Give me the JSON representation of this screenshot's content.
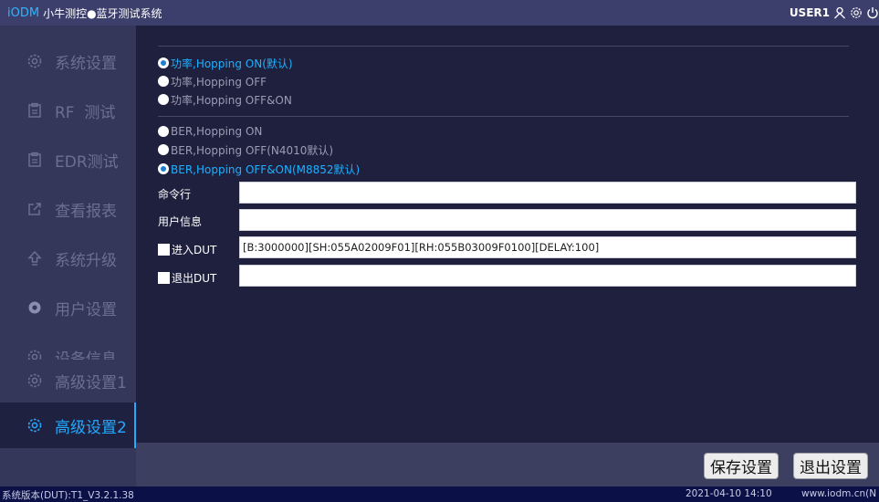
{
  "titlebar": {
    "brand": "iODM",
    "title": " 小牛测控●蓝牙测试系统",
    "user": "USER1",
    "icons": [
      "user-icon",
      "gear-icon",
      "power-icon"
    ]
  },
  "sidebar": {
    "items": [
      {
        "label": "系统设置",
        "icon": "gear-icon"
      },
      {
        "label": "RF  测试",
        "icon": "clipboard-icon"
      },
      {
        "label": "EDR测试",
        "icon": "clipboard-icon"
      },
      {
        "label": "查看报表",
        "icon": "export-icon"
      },
      {
        "label": "系统升级",
        "icon": "upload-arrow-icon"
      },
      {
        "label": "用户设置",
        "icon": "gear-filled-icon"
      },
      {
        "label": "设备信息",
        "icon": "gear-icon"
      },
      {
        "label": "高级设置1",
        "icon": "gear-icon"
      },
      {
        "label": "高级设置2",
        "icon": "gear-icon"
      }
    ],
    "active_index": 8
  },
  "power_options": [
    {
      "label": "功率,Hopping ON(默认)",
      "selected": true
    },
    {
      "label": "功率,Hopping OFF",
      "selected": false
    },
    {
      "label": "功率,Hopping OFF&ON",
      "selected": false
    }
  ],
  "ber_options": [
    {
      "label": "BER,Hopping ON",
      "selected": false
    },
    {
      "label": "BER,Hopping OFF(N4010默认)",
      "selected": false
    },
    {
      "label": "BER,Hopping OFF&ON(M8852默认)",
      "selected": true
    }
  ],
  "fields": {
    "command_line": {
      "label": "命令行",
      "value": ""
    },
    "user_info": {
      "label": "用户信息",
      "value": ""
    },
    "enter_dut": {
      "label": "进入DUT",
      "value": "[B:3000000][SH:055A02009F01][RH:055B03009F0100][DELAY:100]"
    },
    "exit_dut": {
      "label": "退出DUT",
      "value": ""
    }
  },
  "buttons": {
    "save": "保存设置",
    "exit": "退出设置"
  },
  "status": {
    "version": "系统版本(DUT):T1_V3.2.1.38",
    "datetime": "2021-04-10 14:10",
    "url": "www.iodm.cn(N"
  },
  "colors": {
    "accent": "#23a9ff",
    "titlebar": "#3c3f6b",
    "sidebar": "#34365a",
    "content": "#1f203d",
    "statusbar": "#0b1146"
  }
}
